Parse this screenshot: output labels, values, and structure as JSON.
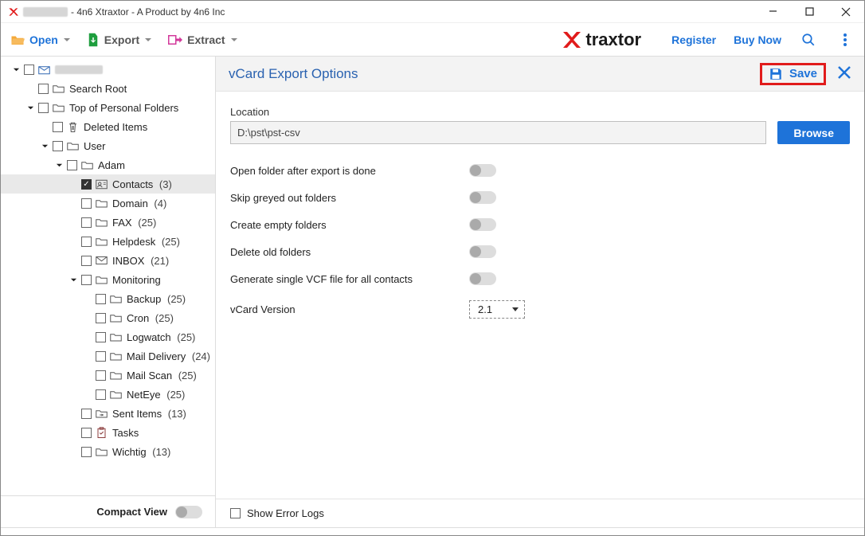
{
  "window": {
    "title_suffix": "- 4n6 Xtraxtor - A Product by 4n6 Inc"
  },
  "toolbar": {
    "open": "Open",
    "export": "Export",
    "extract": "Extract",
    "brand": "traxtor",
    "register": "Register",
    "buy_now": "Buy Now"
  },
  "sidebar": {
    "compact_view": "Compact View",
    "tree": [
      {
        "indent": 0,
        "caret": "down",
        "checked": false,
        "icon": "mailbox",
        "label": "__BLUR__",
        "count": null
      },
      {
        "indent": 1,
        "caret": "none",
        "checked": false,
        "icon": "folder",
        "label": "Search Root",
        "count": null
      },
      {
        "indent": 1,
        "caret": "down",
        "checked": false,
        "icon": "folder",
        "label": "Top of Personal Folders",
        "count": null
      },
      {
        "indent": 2,
        "caret": "none",
        "checked": false,
        "icon": "trash",
        "label": "Deleted Items",
        "count": null
      },
      {
        "indent": 2,
        "caret": "down",
        "checked": false,
        "icon": "folder",
        "label": "User",
        "count": null
      },
      {
        "indent": 3,
        "caret": "down",
        "checked": false,
        "icon": "folder",
        "label": "Adam",
        "count": null
      },
      {
        "indent": 4,
        "caret": "none",
        "checked": true,
        "icon": "contacts",
        "label": "Contacts",
        "count": "(3)",
        "selected": true
      },
      {
        "indent": 4,
        "caret": "none",
        "checked": false,
        "icon": "folder",
        "label": "Domain",
        "count": "(4)"
      },
      {
        "indent": 4,
        "caret": "none",
        "checked": false,
        "icon": "folder",
        "label": "FAX",
        "count": "(25)"
      },
      {
        "indent": 4,
        "caret": "none",
        "checked": false,
        "icon": "folder",
        "label": "Helpdesk",
        "count": "(25)"
      },
      {
        "indent": 4,
        "caret": "none",
        "checked": false,
        "icon": "mail",
        "label": "INBOX",
        "count": "(21)"
      },
      {
        "indent": 4,
        "caret": "down",
        "checked": false,
        "icon": "folder",
        "label": "Monitoring",
        "count": null
      },
      {
        "indent": 5,
        "caret": "none",
        "checked": false,
        "icon": "folder",
        "label": "Backup",
        "count": "(25)"
      },
      {
        "indent": 5,
        "caret": "none",
        "checked": false,
        "icon": "folder",
        "label": "Cron",
        "count": "(25)"
      },
      {
        "indent": 5,
        "caret": "none",
        "checked": false,
        "icon": "folder",
        "label": "Logwatch",
        "count": "(25)"
      },
      {
        "indent": 5,
        "caret": "none",
        "checked": false,
        "icon": "folder",
        "label": "Mail Delivery",
        "count": "(24)"
      },
      {
        "indent": 5,
        "caret": "none",
        "checked": false,
        "icon": "folder",
        "label": "Mail Scan",
        "count": "(25)"
      },
      {
        "indent": 5,
        "caret": "none",
        "checked": false,
        "icon": "folder",
        "label": "NetEye",
        "count": "(25)"
      },
      {
        "indent": 4,
        "caret": "none",
        "checked": false,
        "icon": "sent",
        "label": "Sent Items",
        "count": "(13)"
      },
      {
        "indent": 4,
        "caret": "none",
        "checked": false,
        "icon": "tasks",
        "label": "Tasks",
        "count": null
      },
      {
        "indent": 4,
        "caret": "none",
        "checked": false,
        "icon": "folder",
        "label": "Wichtig",
        "count": "(13)"
      }
    ]
  },
  "panel": {
    "title": "vCard Export Options",
    "save": "Save",
    "location_label": "Location",
    "location_value": "D:\\pst\\pst-csv",
    "browse": "Browse",
    "options": [
      "Open folder after export is done",
      "Skip greyed out folders",
      "Create empty folders",
      "Delete old folders",
      "Generate single VCF file for all contacts"
    ],
    "vcard_version_label": "vCard Version",
    "vcard_version_value": "2.1",
    "show_error_logs": "Show Error Logs"
  }
}
